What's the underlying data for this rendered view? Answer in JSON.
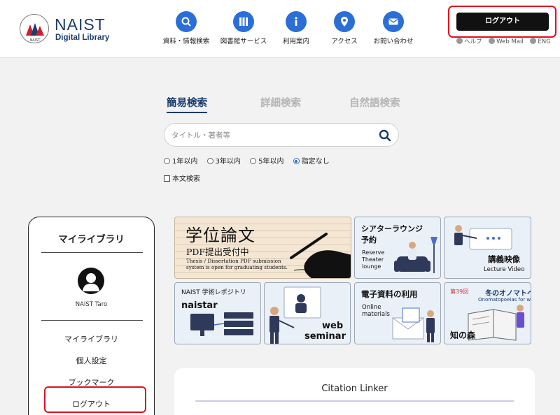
{
  "header": {
    "logo": {
      "name": "NAIST",
      "subtitle": "Digital Library",
      "seal_text": "NAIST"
    },
    "nav": [
      {
        "label": "資料・情報検索",
        "icon": "search-icon"
      },
      {
        "label": "図書館サービス",
        "icon": "books-icon"
      },
      {
        "label": "利用案内",
        "icon": "info-icon"
      },
      {
        "label": "アクセス",
        "icon": "map-pin-icon"
      },
      {
        "label": "お問い合わせ",
        "icon": "mail-icon"
      }
    ],
    "logout_label": "ログアウト",
    "utility_links": [
      "ヘルプ",
      "Web Mail",
      "ENG"
    ]
  },
  "search": {
    "tabs": [
      "簡易検索",
      "詳細検索",
      "自然語検索"
    ],
    "active_tab": "簡易検索",
    "placeholder": "タイトル・著者等",
    "value": "",
    "period_options": [
      "1年以内",
      "3年以内",
      "5年以内",
      "指定なし"
    ],
    "selected_period": "指定なし",
    "fulltext_label": "本文検索",
    "fulltext_checked": false
  },
  "sidebar": {
    "title": "マイライブラリ",
    "user_name": "NAIST Taro",
    "links": [
      "マイライブラリ",
      "個人設定",
      "ブックマーク",
      "ログアウト"
    ]
  },
  "banners": {
    "thesis": {
      "title": "学位論文",
      "subtitle": "PDF提出受付中",
      "text": "Thesis / Dissertation PDF submission system is open for graduating students."
    },
    "theater": {
      "title": "シアターラウンジ",
      "title2": "予約",
      "text": "Reserve Theater lounge"
    },
    "lecture": {
      "title": "講義映像",
      "text": "Lecture Video"
    },
    "naistar": {
      "title": "NAIST 学術レポジトリ",
      "name": "naistar"
    },
    "webinar": {
      "line1": "web",
      "line2": "seminar"
    },
    "eresources": {
      "title": "電子資料の利用",
      "text": "Online materials"
    },
    "onomatopoeia": {
      "number": "第39回",
      "title": "冬のオノマトペ",
      "subtitle": "Onomatopoeias for winter",
      "footer": "知の森"
    }
  },
  "citation": {
    "title": "Citation Linker"
  },
  "colors": {
    "accent": "#2b6fd6",
    "navy": "#1a3c6e",
    "highlight": "#e0101c"
  }
}
